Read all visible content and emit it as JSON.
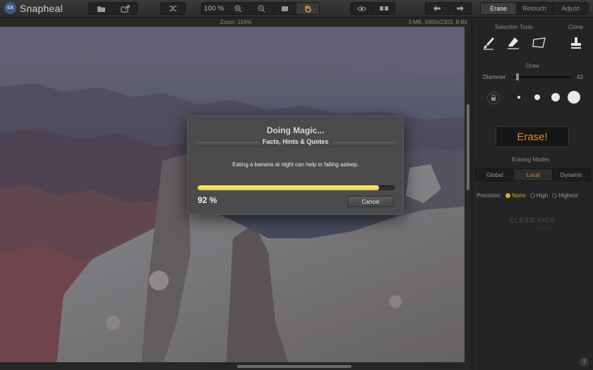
{
  "app": {
    "name": "Snapheal",
    "logo_badge": "SX"
  },
  "toolbar": {
    "open_icon": "folder-icon",
    "export_icon": "share-icon",
    "shuffle_icon": "shuffle-icon",
    "zoom_value": "100 %",
    "zoom_in_icon": "zoom-in-icon",
    "zoom_out_icon": "zoom-out-icon",
    "fit_icon": "fit-screen-icon",
    "hand_icon": "hand-icon",
    "preview_icon": "eye-icon",
    "compare_icon": "split-view-icon",
    "undo_icon": "undo-icon",
    "redo_icon": "redo-icon",
    "accent_color": "#f0b63c"
  },
  "mode_tabs": [
    {
      "label": "Erase",
      "active": true
    },
    {
      "label": "Retouch",
      "active": false
    },
    {
      "label": "Adjust",
      "active": false
    }
  ],
  "status": {
    "zoom": "Zoom: 116%",
    "info": "3 MB, 3450x2303, 8-Bit"
  },
  "dialog": {
    "title": "Doing Magic...",
    "subtitle": "Facts, Hints & Quotes",
    "message": "Eating a banana at night can help in falling asleep.",
    "progress_percent": 92,
    "progress_label": "92 %",
    "cancel_label": "Cancel",
    "progress_color": "#f0dc4a"
  },
  "panel": {
    "selection_tools_label": "Selection Tools",
    "clone_label": "Clone",
    "draw_label": "Draw",
    "diameter_label": "Diameter",
    "diameter_value": "42",
    "diameter_fraction": 0.05,
    "erase_button": "Erase!",
    "erase_color": "#e08a2c",
    "erasing_modes_label": "Erasing Modes",
    "modes": [
      {
        "label": "Global",
        "active": false
      },
      {
        "label": "Local",
        "active": true
      },
      {
        "label": "Dynamic",
        "active": false
      }
    ],
    "precision_label": "Precision:",
    "precision": [
      {
        "label": "Norm",
        "active": true
      },
      {
        "label": "High",
        "active": false
      },
      {
        "label": "Highest",
        "active": false
      }
    ],
    "brand_mark": "CLEAR PICS",
    "brand_sub": "MACPHUN",
    "help_label": "?"
  }
}
